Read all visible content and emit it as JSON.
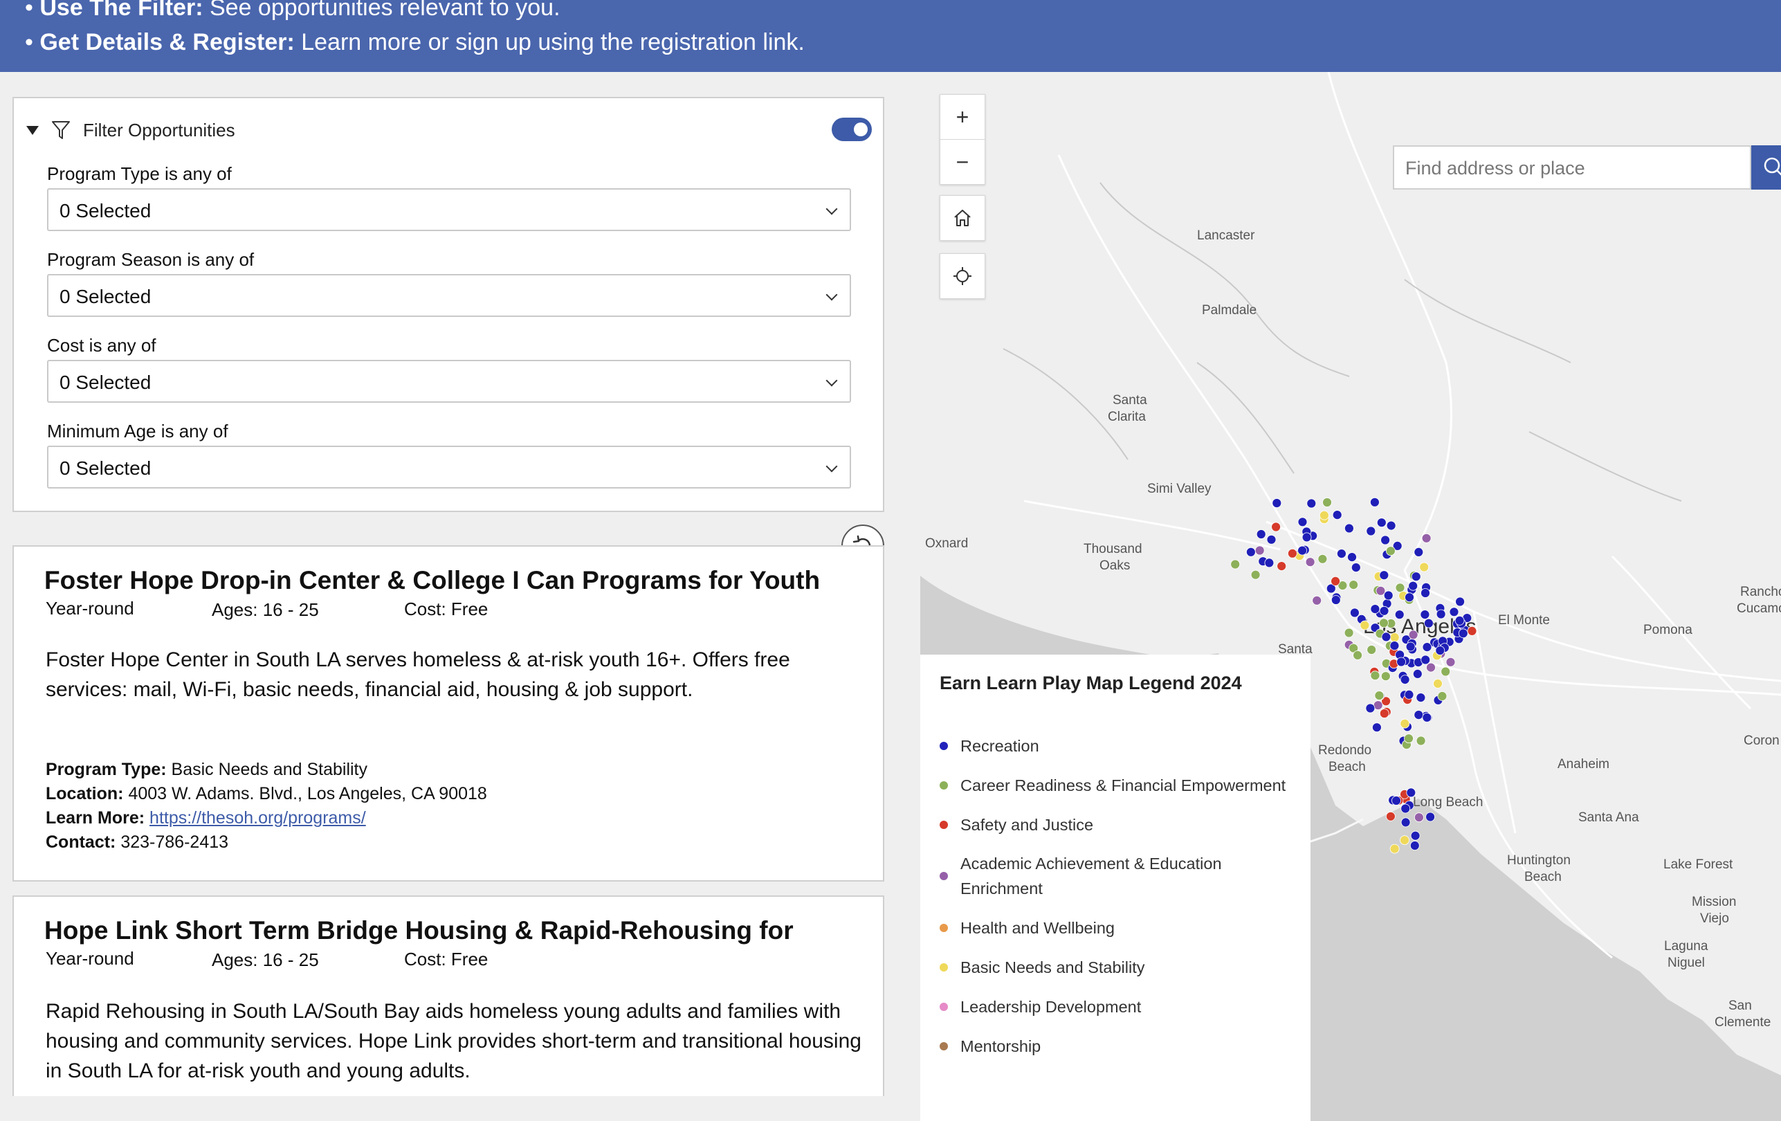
{
  "banner": {
    "item1_label": "Use The Filter:",
    "item1_text": " See opportunities relevant to you.",
    "item2_label": "Get Details & Register:",
    "item2_text": " Learn more or sign up using the registration link."
  },
  "filter": {
    "title": "Filter Opportunities",
    "enabled": true,
    "fields": [
      {
        "label": "Program Type is any of",
        "value": "0 Selected"
      },
      {
        "label": "Program Season is any of",
        "value": "0 Selected"
      },
      {
        "label": "Cost is any of",
        "value": "0 Selected"
      },
      {
        "label": "Minimum Age is any of",
        "value": "0 Selected"
      }
    ]
  },
  "cards": [
    {
      "title": "Foster Hope Drop-in Center & College I Can Programs for Youth",
      "season": "Year-round",
      "ages": "Ages: 16 - 25",
      "cost": "Cost: Free",
      "description": "Foster Hope Center in South LA serves homeless & at-risk youth 16+. Offers free services: mail, Wi-Fi, basic needs, financial aid, housing & job support.",
      "program_type_label": "Program Type:",
      "program_type": " Basic Needs and Stability",
      "location_label": "Location:",
      "location": " 4003 W. Adams. Blvd., Los Angeles, CA 90018",
      "learn_more_label": "Learn More:",
      "learn_more_url": "https://thesoh.org/programs/",
      "contact_label": "Contact:",
      "contact": " 323-786-2413"
    },
    {
      "title": "Hope Link Short Term Bridge Housing & Rapid-Rehousing for",
      "season": "Year-round",
      "ages": "Ages: 16 - 25",
      "cost": "Cost: Free",
      "description": "Rapid Rehousing in South LA/South Bay aids homeless young adults and families with housing and community services. Hope Link provides short-term and transitional housing in South LA for at-risk youth and young adults."
    }
  ],
  "map": {
    "search_placeholder": "Find address or place",
    "zoom_in": "+",
    "zoom_out": "−",
    "labels": {
      "lancaster": "Lancaster",
      "palmdale": "Palmdale",
      "santa_clarita_1": "Santa",
      "santa_clarita_2": "Clarita",
      "simi_valley": "Simi Valley",
      "oxnard": "Oxnard",
      "thousand_oaks_1": "Thousand",
      "thousand_oaks_2": "Oaks",
      "los_angeles": "Los Angeles",
      "el_monte": "El Monte",
      "pomona": "Pomona",
      "rancho_1": "Rancho",
      "rancho_2": "Cucamon",
      "santa_monica": "Santa",
      "corona": "Coron",
      "redondo_1": "Redondo",
      "redondo_2": "Beach",
      "anaheim": "Anaheim",
      "long_beach": "Long Beach",
      "santa_ana": "Santa Ana",
      "huntington_1": "Huntington",
      "huntington_2": "Beach",
      "lake_forest": "Lake Forest",
      "mission_1": "Mission",
      "mission_2": "Viejo",
      "laguna_1": "Laguna",
      "laguna_2": "Niguel",
      "san_clemente_1": "San",
      "san_clemente_2": "Clemente"
    }
  },
  "legend": {
    "title": "Earn Learn Play Map Legend 2024",
    "items": [
      {
        "label": "Recreation",
        "color": "#2222bb"
      },
      {
        "label": "Career Readiness & Financial Empowerment",
        "color": "#8db05a"
      },
      {
        "label": "Safety and Justice",
        "color": "#d63a2a"
      },
      {
        "label": "Academic Achievement & Education Enrichment",
        "color": "#9560a8"
      },
      {
        "label": "Health and Wellbeing",
        "color": "#e89a4a"
      },
      {
        "label": "Basic Needs and Stability",
        "color": "#efd95a"
      },
      {
        "label": "Leadership Development",
        "color": "#e68ac8"
      },
      {
        "label": "Mentorship",
        "color": "#a87a50"
      }
    ]
  }
}
